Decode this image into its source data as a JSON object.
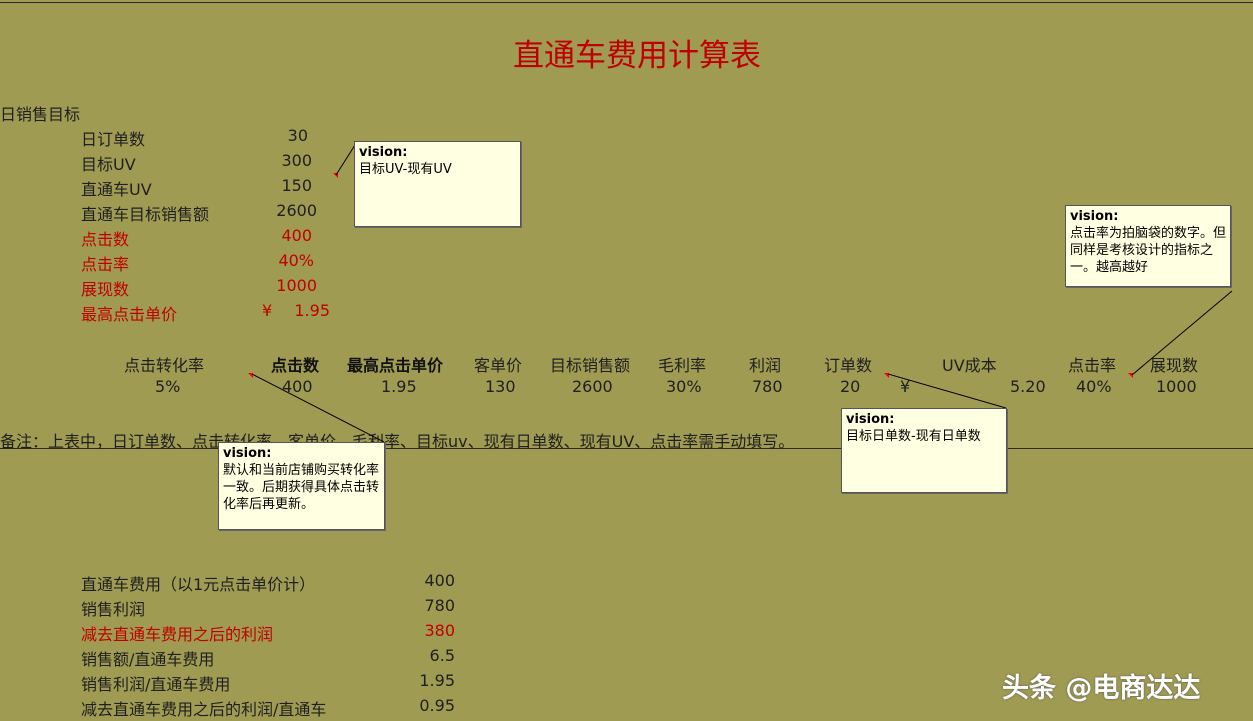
{
  "title": "直通车费用计算表",
  "section_label": "日销售目标",
  "targets": [
    {
      "label": "日订单数",
      "value": "30",
      "red": false
    },
    {
      "label": "目标UV",
      "value": "300",
      "red": false
    },
    {
      "label": "直通车UV",
      "value": "150",
      "red": false
    },
    {
      "label": "直通车目标销售额",
      "value": "2600",
      "red": false
    },
    {
      "label": "点击数",
      "value": "400",
      "red": true
    },
    {
      "label": "点击率",
      "value": "40%",
      "red": true
    },
    {
      "label": "展现数",
      "value": "1000",
      "red": true
    },
    {
      "label": "最高点击单价",
      "currency": "¥",
      "value": "1.95",
      "red": true
    }
  ],
  "table": {
    "headers": [
      "点击转化率",
      "点击数",
      "最高点击单价",
      "客单价",
      "目标销售额",
      "毛利率",
      "利润",
      "订单数",
      "UV成本",
      "点击率",
      "展现数"
    ],
    "values": [
      "5%",
      "400",
      "1.95",
      "130",
      "2600",
      "30%",
      "780",
      "20",
      "5.20",
      "40%",
      "1000"
    ],
    "uv_currency": "¥"
  },
  "remark": "备注：上表中，日订单数、点击转化率、客单价、毛利率、目标uv、现有日单数、现有UV、点击率需手动填写。",
  "summary": [
    {
      "label": "直通车费用（以1元点击单价计）",
      "value": "400",
      "red": false
    },
    {
      "label": "销售利润",
      "value": "780",
      "red": false
    },
    {
      "label": "减去直通车费用之后的利润",
      "value": "380",
      "red": true
    },
    {
      "label": "销售额/直通车费用",
      "value": "6.5",
      "red": false
    },
    {
      "label": "销售利润/直通车费用",
      "value": "1.95",
      "red": false
    },
    {
      "label": "减去直通车费用之后的利润/直通车",
      "value": "0.95",
      "red": false
    }
  ],
  "comments": [
    {
      "author": "vision:",
      "text": "目标UV-现有UV"
    },
    {
      "author": "vision:",
      "text": "点击率为拍脑袋的数字。但同样是考核设计的指标之一。越高越好"
    },
    {
      "author": "vision:",
      "text": "默认和当前店铺购买转化率一致。后期获得具体点击转化率后再更新。"
    },
    {
      "author": "vision:",
      "text": "目标日单数-现有日单数"
    }
  ],
  "watermark": "头条 @电商达达"
}
